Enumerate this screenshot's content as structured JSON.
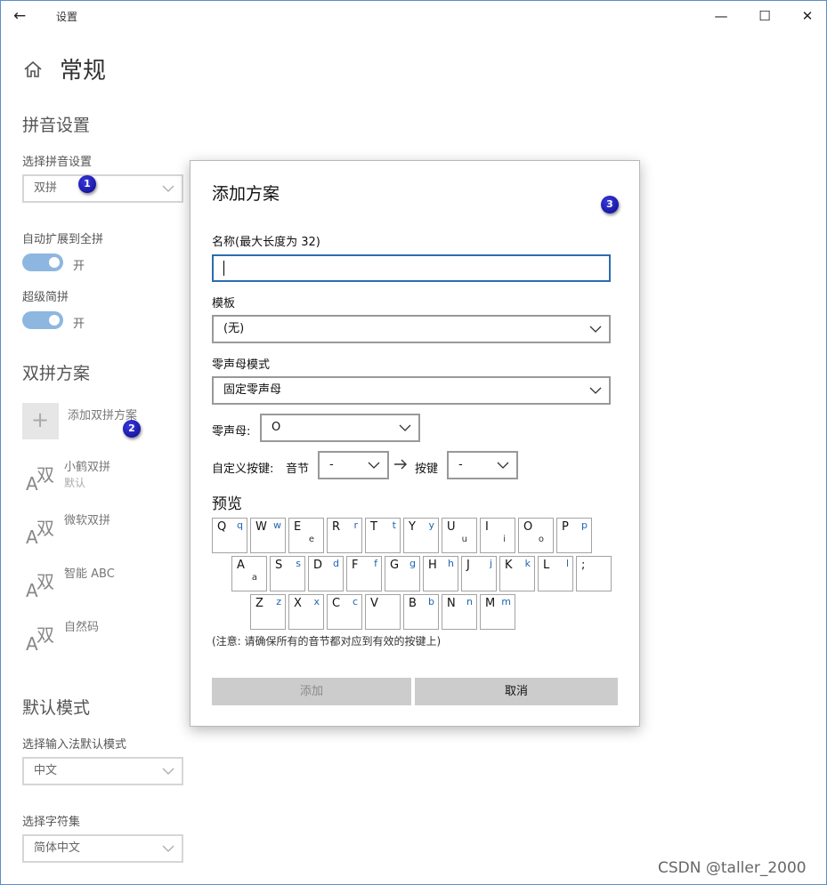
{
  "titlebar": {
    "app_title": "设置",
    "back_glyph": "←",
    "minimize_glyph": "—",
    "maximize_glyph": "☐",
    "close_glyph": "✕"
  },
  "page": {
    "title": "常规"
  },
  "pinyin_settings": {
    "heading": "拼音设置",
    "select_label": "选择拼音设置",
    "select_value": "双拼",
    "auto_expand_label": "自动扩展到全拼",
    "auto_expand_state": "开",
    "super_abbr_label": "超级简拼",
    "super_abbr_state": "开"
  },
  "shuangpin_schemes": {
    "heading": "双拼方案",
    "add_label": "添加双拼方案",
    "plus_glyph": "+",
    "icon_big": "A",
    "icon_small": "双",
    "items": [
      {
        "name": "小鹤双拼",
        "sub": "默认"
      },
      {
        "name": "微软双拼",
        "sub": ""
      },
      {
        "name": "智能 ABC",
        "sub": ""
      },
      {
        "name": "自然码",
        "sub": ""
      }
    ]
  },
  "default_mode": {
    "heading": "默认模式",
    "mode_label": "选择输入法默认模式",
    "mode_value": "中文",
    "charset_label": "选择字符集",
    "charset_value": "简体中文"
  },
  "badges": [
    "1",
    "2",
    "3"
  ],
  "dialog": {
    "title": "添加方案",
    "name_label": "名称(最大长度为 32)",
    "name_value": "",
    "template_label": "模板",
    "template_value": "(无)",
    "zero_mode_label": "零声母模式",
    "zero_mode_value": "固定零声母",
    "zero_initial_label": "零声母:",
    "zero_initial_value": "O",
    "custom_key_label": "自定义按键:",
    "syllable_label": "音节",
    "syllable_value": "-",
    "key_label": "按键",
    "key_value": "-",
    "preview_label": "预览",
    "keyboard_rows": [
      [
        {
          "key": "Q",
          "map": "q",
          "bottom": ""
        },
        {
          "key": "W",
          "map": "w",
          "bottom": ""
        },
        {
          "key": "E",
          "map": "",
          "bottom": "e"
        },
        {
          "key": "R",
          "map": "r",
          "bottom": ""
        },
        {
          "key": "T",
          "map": "t",
          "bottom": ""
        },
        {
          "key": "Y",
          "map": "y",
          "bottom": ""
        },
        {
          "key": "U",
          "map": "",
          "bottom": "u"
        },
        {
          "key": "I",
          "map": "",
          "bottom": "i"
        },
        {
          "key": "O",
          "map": "",
          "bottom": "o"
        },
        {
          "key": "P",
          "map": "p",
          "bottom": ""
        }
      ],
      [
        {
          "key": "A",
          "map": "",
          "bottom": "a"
        },
        {
          "key": "S",
          "map": "s",
          "bottom": ""
        },
        {
          "key": "D",
          "map": "d",
          "bottom": ""
        },
        {
          "key": "F",
          "map": "f",
          "bottom": ""
        },
        {
          "key": "G",
          "map": "g",
          "bottom": ""
        },
        {
          "key": "H",
          "map": "h",
          "bottom": ""
        },
        {
          "key": "J",
          "map": "j",
          "bottom": ""
        },
        {
          "key": "K",
          "map": "k",
          "bottom": ""
        },
        {
          "key": "L",
          "map": "l",
          "bottom": ""
        },
        {
          "key": ";",
          "map": "",
          "bottom": ""
        }
      ],
      [
        {
          "key": "Z",
          "map": "z",
          "bottom": ""
        },
        {
          "key": "X",
          "map": "x",
          "bottom": ""
        },
        {
          "key": "C",
          "map": "c",
          "bottom": ""
        },
        {
          "key": "V",
          "map": "",
          "bottom": ""
        },
        {
          "key": "B",
          "map": "b",
          "bottom": ""
        },
        {
          "key": "N",
          "map": "n",
          "bottom": ""
        },
        {
          "key": "M",
          "map": "m",
          "bottom": ""
        }
      ]
    ],
    "note": "(注意: 请确保所有的音节都对应到有效的按键上)",
    "add_button": "添加",
    "cancel_button": "取消"
  },
  "watermark": "CSDN @taller_2000",
  "colors": {
    "accent": "#2b6cb0",
    "toggle_on": "#8db7e0",
    "mapping_text": "#1f65b0",
    "badge": "#0a0a8a"
  }
}
